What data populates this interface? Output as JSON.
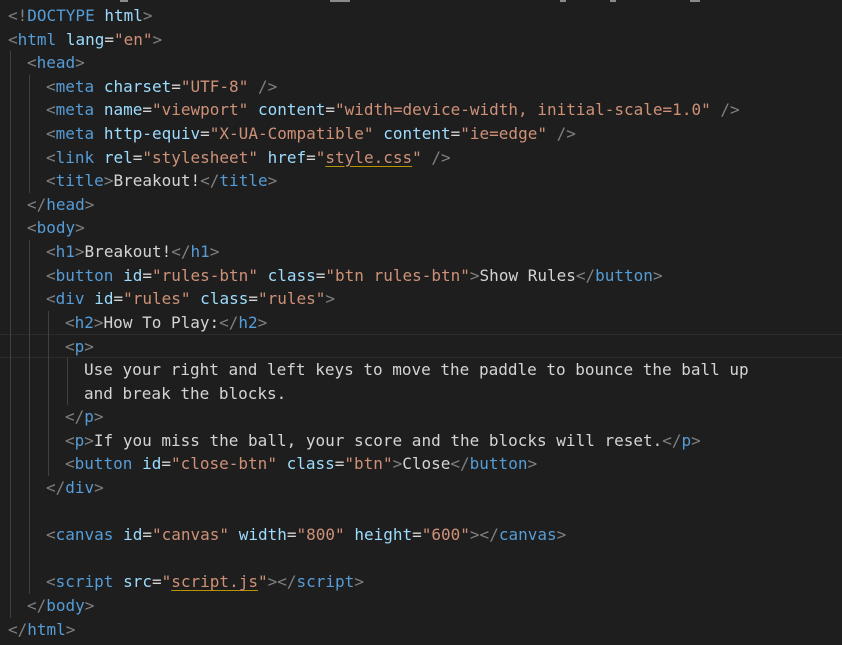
{
  "lines": [
    {
      "indent": 0,
      "tokens": [
        [
          "b",
          "<!"
        ],
        [
          "t",
          "DOCTYPE"
        ],
        [
          "tx",
          " "
        ],
        [
          "a",
          "html"
        ],
        [
          "b",
          ">"
        ]
      ]
    },
    {
      "indent": 0,
      "tokens": [
        [
          "b",
          "<"
        ],
        [
          "t",
          "html"
        ],
        [
          "tx",
          " "
        ],
        [
          "a",
          "lang"
        ],
        [
          "tx",
          "="
        ],
        [
          "s",
          "\"en\""
        ],
        [
          "b",
          ">"
        ]
      ]
    },
    {
      "indent": 1,
      "tokens": [
        [
          "b",
          "<"
        ],
        [
          "t",
          "head"
        ],
        [
          "b",
          ">"
        ]
      ]
    },
    {
      "indent": 2,
      "tokens": [
        [
          "b",
          "<"
        ],
        [
          "t",
          "meta"
        ],
        [
          "tx",
          " "
        ],
        [
          "a",
          "charset"
        ],
        [
          "tx",
          "="
        ],
        [
          "s",
          "\"UTF-8\""
        ],
        [
          "tx",
          " "
        ],
        [
          "b",
          "/>"
        ]
      ]
    },
    {
      "indent": 2,
      "tokens": [
        [
          "b",
          "<"
        ],
        [
          "t",
          "meta"
        ],
        [
          "tx",
          " "
        ],
        [
          "a",
          "name"
        ],
        [
          "tx",
          "="
        ],
        [
          "s",
          "\"viewport\""
        ],
        [
          "tx",
          " "
        ],
        [
          "a",
          "content"
        ],
        [
          "tx",
          "="
        ],
        [
          "s",
          "\"width=device-width, initial-scale=1.0\""
        ],
        [
          "tx",
          " "
        ],
        [
          "b",
          "/>"
        ]
      ]
    },
    {
      "indent": 2,
      "tokens": [
        [
          "b",
          "<"
        ],
        [
          "t",
          "meta"
        ],
        [
          "tx",
          " "
        ],
        [
          "a",
          "http-equiv"
        ],
        [
          "tx",
          "="
        ],
        [
          "s",
          "\"X-UA-Compatible\""
        ],
        [
          "tx",
          " "
        ],
        [
          "a",
          "content"
        ],
        [
          "tx",
          "="
        ],
        [
          "s",
          "\"ie=edge\""
        ],
        [
          "tx",
          " "
        ],
        [
          "b",
          "/>"
        ]
      ]
    },
    {
      "indent": 2,
      "tokens": [
        [
          "b",
          "<"
        ],
        [
          "t",
          "link"
        ],
        [
          "tx",
          " "
        ],
        [
          "a",
          "rel"
        ],
        [
          "tx",
          "="
        ],
        [
          "s",
          "\"stylesheet\""
        ],
        [
          "tx",
          " "
        ],
        [
          "a",
          "href"
        ],
        [
          "tx",
          "="
        ],
        [
          "s",
          "\""
        ],
        [
          "sl",
          "style.css"
        ],
        [
          "s",
          "\""
        ],
        [
          "tx",
          " "
        ],
        [
          "b",
          "/>"
        ]
      ]
    },
    {
      "indent": 2,
      "tokens": [
        [
          "b",
          "<"
        ],
        [
          "t",
          "title"
        ],
        [
          "b",
          ">"
        ],
        [
          "tx",
          "Breakout!"
        ],
        [
          "b",
          "</"
        ],
        [
          "t",
          "title"
        ],
        [
          "b",
          ">"
        ]
      ]
    },
    {
      "indent": 1,
      "tokens": [
        [
          "b",
          "</"
        ],
        [
          "t",
          "head"
        ],
        [
          "b",
          ">"
        ]
      ]
    },
    {
      "indent": 1,
      "tokens": [
        [
          "b",
          "<"
        ],
        [
          "t",
          "body"
        ],
        [
          "b",
          ">"
        ]
      ]
    },
    {
      "indent": 2,
      "tokens": [
        [
          "b",
          "<"
        ],
        [
          "t",
          "h1"
        ],
        [
          "b",
          ">"
        ],
        [
          "tx",
          "Breakout!"
        ],
        [
          "b",
          "</"
        ],
        [
          "t",
          "h1"
        ],
        [
          "b",
          ">"
        ]
      ]
    },
    {
      "indent": 2,
      "tokens": [
        [
          "b",
          "<"
        ],
        [
          "t",
          "button"
        ],
        [
          "tx",
          " "
        ],
        [
          "a",
          "id"
        ],
        [
          "tx",
          "="
        ],
        [
          "s",
          "\"rules-btn\""
        ],
        [
          "tx",
          " "
        ],
        [
          "a",
          "class"
        ],
        [
          "tx",
          "="
        ],
        [
          "s",
          "\"btn rules-btn\""
        ],
        [
          "b",
          ">"
        ],
        [
          "tx",
          "Show Rules"
        ],
        [
          "b",
          "</"
        ],
        [
          "t",
          "button"
        ],
        [
          "b",
          ">"
        ]
      ]
    },
    {
      "indent": 2,
      "tokens": [
        [
          "b",
          "<"
        ],
        [
          "t",
          "div"
        ],
        [
          "tx",
          " "
        ],
        [
          "a",
          "id"
        ],
        [
          "tx",
          "="
        ],
        [
          "s",
          "\"rules\""
        ],
        [
          "tx",
          " "
        ],
        [
          "a",
          "class"
        ],
        [
          "tx",
          "="
        ],
        [
          "s",
          "\"rules\""
        ],
        [
          "b",
          ">"
        ]
      ]
    },
    {
      "indent": 3,
      "tokens": [
        [
          "b",
          "<"
        ],
        [
          "t",
          "h2"
        ],
        [
          "b",
          ">"
        ],
        [
          "tx",
          "How To Play:"
        ],
        [
          "b",
          "</"
        ],
        [
          "t",
          "h2"
        ],
        [
          "b",
          ">"
        ]
      ]
    },
    {
      "indent": 3,
      "current": true,
      "tokens": [
        [
          "b",
          "<"
        ],
        [
          "t",
          "p"
        ],
        [
          "b",
          ">"
        ]
      ]
    },
    {
      "indent": 4,
      "tokens": [
        [
          "tx",
          "Use your right and left keys to move the paddle to bounce the ball up"
        ]
      ]
    },
    {
      "indent": 4,
      "tokens": [
        [
          "tx",
          "and break the blocks."
        ]
      ]
    },
    {
      "indent": 3,
      "tokens": [
        [
          "b",
          "</"
        ],
        [
          "t",
          "p"
        ],
        [
          "b",
          ">"
        ]
      ]
    },
    {
      "indent": 3,
      "tokens": [
        [
          "b",
          "<"
        ],
        [
          "t",
          "p"
        ],
        [
          "b",
          ">"
        ],
        [
          "tx",
          "If you miss the ball, your score and the blocks will reset."
        ],
        [
          "b",
          "</"
        ],
        [
          "t",
          "p"
        ],
        [
          "b",
          ">"
        ]
      ]
    },
    {
      "indent": 3,
      "tokens": [
        [
          "b",
          "<"
        ],
        [
          "t",
          "button"
        ],
        [
          "tx",
          " "
        ],
        [
          "a",
          "id"
        ],
        [
          "tx",
          "="
        ],
        [
          "s",
          "\"close-btn\""
        ],
        [
          "tx",
          " "
        ],
        [
          "a",
          "class"
        ],
        [
          "tx",
          "="
        ],
        [
          "s",
          "\"btn\""
        ],
        [
          "b",
          ">"
        ],
        [
          "tx",
          "Close"
        ],
        [
          "b",
          "</"
        ],
        [
          "t",
          "button"
        ],
        [
          "b",
          ">"
        ]
      ]
    },
    {
      "indent": 2,
      "tokens": [
        [
          "b",
          "</"
        ],
        [
          "t",
          "div"
        ],
        [
          "b",
          ">"
        ]
      ]
    },
    {
      "indent": 0,
      "tokens": []
    },
    {
      "indent": 2,
      "tokens": [
        [
          "b",
          "<"
        ],
        [
          "t",
          "canvas"
        ],
        [
          "tx",
          " "
        ],
        [
          "a",
          "id"
        ],
        [
          "tx",
          "="
        ],
        [
          "s",
          "\"canvas\""
        ],
        [
          "tx",
          " "
        ],
        [
          "a",
          "width"
        ],
        [
          "tx",
          "="
        ],
        [
          "s",
          "\"800\""
        ],
        [
          "tx",
          " "
        ],
        [
          "a",
          "height"
        ],
        [
          "tx",
          "="
        ],
        [
          "s",
          "\"600\""
        ],
        [
          "b",
          "></"
        ],
        [
          "t",
          "canvas"
        ],
        [
          "b",
          ">"
        ]
      ]
    },
    {
      "indent": 0,
      "tokens": []
    },
    {
      "indent": 2,
      "tokens": [
        [
          "b",
          "<"
        ],
        [
          "t",
          "script"
        ],
        [
          "tx",
          " "
        ],
        [
          "a",
          "src"
        ],
        [
          "tx",
          "="
        ],
        [
          "s",
          "\""
        ],
        [
          "sl",
          "script.js"
        ],
        [
          "s",
          "\""
        ],
        [
          "b",
          "></"
        ],
        [
          "t",
          "script"
        ],
        [
          "b",
          ">"
        ]
      ]
    },
    {
      "indent": 1,
      "tokens": [
        [
          "b",
          "</"
        ],
        [
          "t",
          "body"
        ],
        [
          "b",
          ">"
        ]
      ]
    },
    {
      "indent": 0,
      "tokens": [
        [
          "b",
          "</"
        ],
        [
          "t",
          "html"
        ],
        [
          "b",
          ">"
        ]
      ]
    }
  ],
  "colors": {
    "background": "#1e1e1e",
    "tag": "#569cd6",
    "bracket": "#808080",
    "attribute": "#9cdcfe",
    "string": "#ce9178",
    "text": "#d4d4d4"
  }
}
